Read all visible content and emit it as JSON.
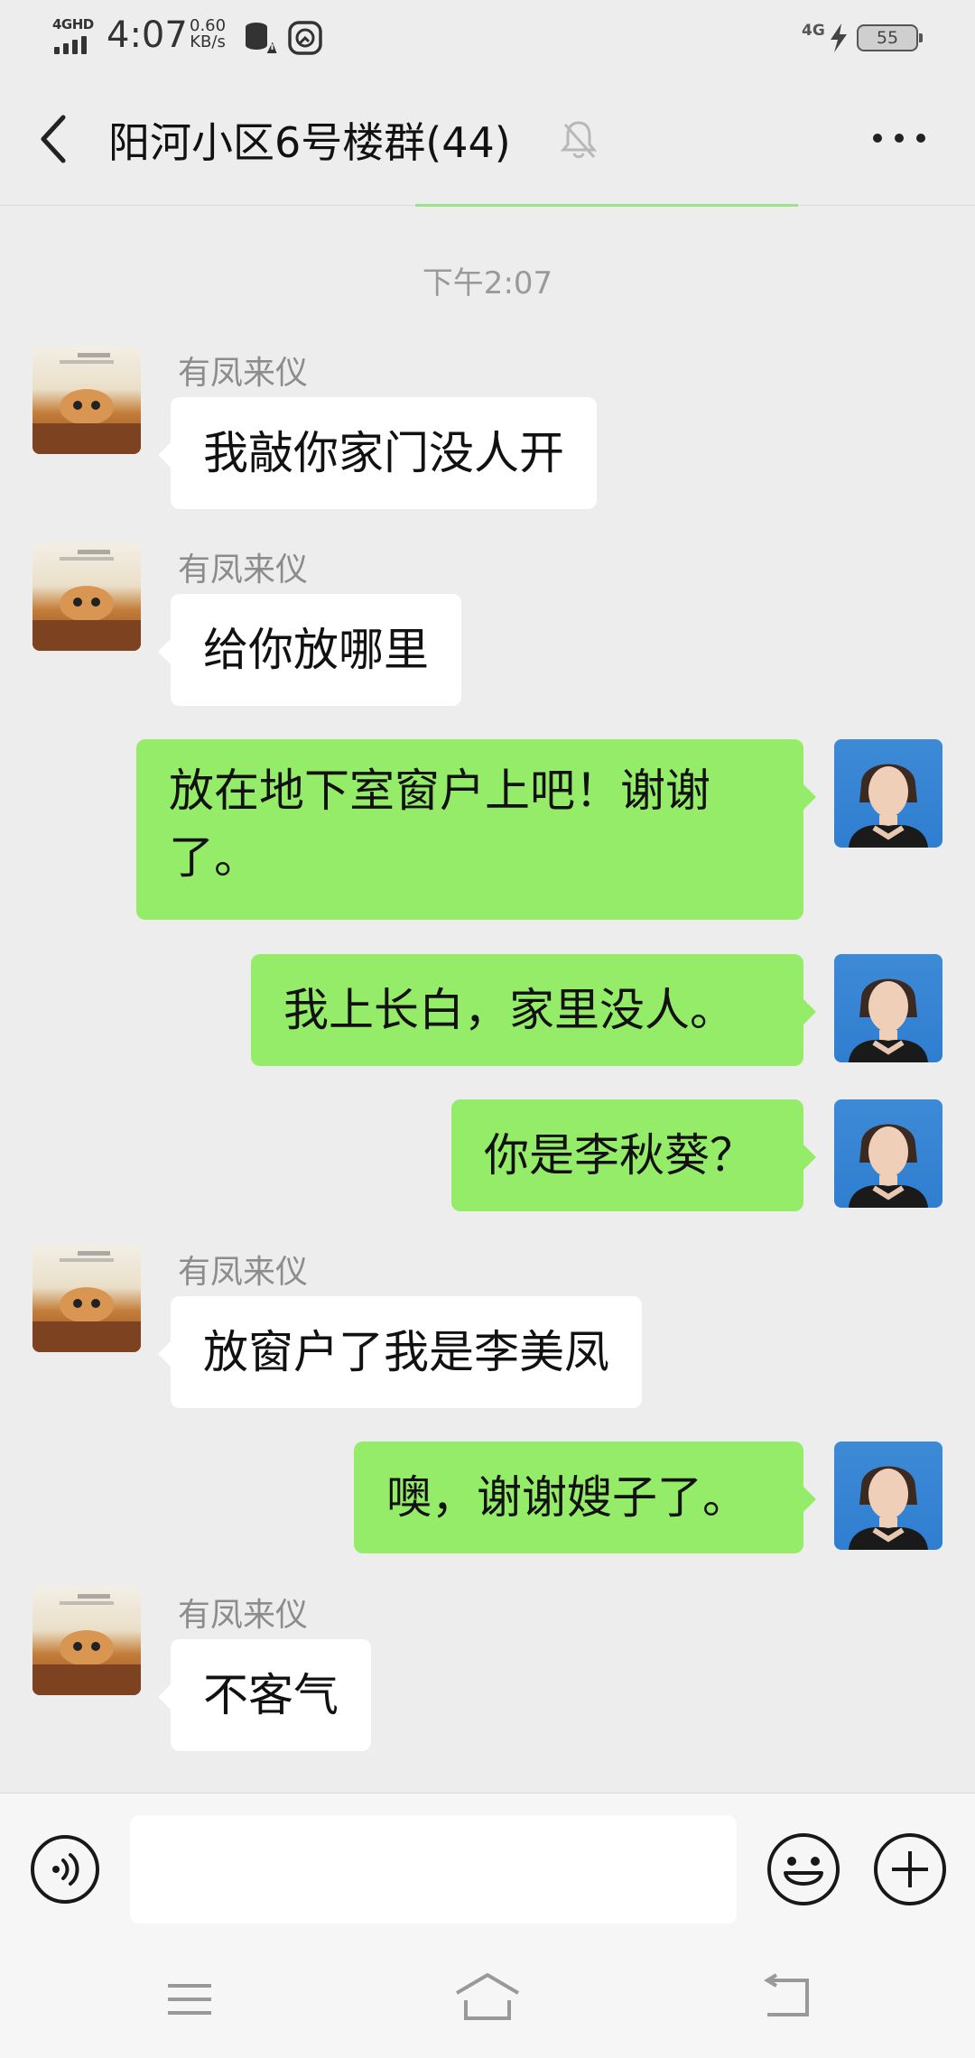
{
  "status_bar": {
    "network_label": "4GHD",
    "time": "4:07",
    "speed_value": "0.60",
    "speed_unit": "KB/s",
    "cell_label": "4G",
    "battery": "55"
  },
  "header": {
    "title": "阳河小区6号楼群(44)",
    "icons": [
      "back-arrow-icon",
      "mute-bell-icon",
      "more-dots-icon"
    ]
  },
  "timestamp": "下午2:07",
  "messages": [
    {
      "direction": "in",
      "sender": "有凤来仪",
      "text": "我敲你家门没人开"
    },
    {
      "direction": "in",
      "sender": "有凤来仪",
      "text": "给你放哪里"
    },
    {
      "direction": "out",
      "line1": "放在地下室窗户上吧！谢谢",
      "line2": "了。"
    },
    {
      "direction": "out",
      "text": "我上长白，家里没人。"
    },
    {
      "direction": "out",
      "text": "你是李秋葵？"
    },
    {
      "direction": "in",
      "sender": "有凤来仪",
      "text": "放窗户了我是李美凤"
    },
    {
      "direction": "out",
      "text": "噢，谢谢嫂子了。"
    },
    {
      "direction": "in",
      "sender": "有凤来仪",
      "text": "不客气"
    }
  ],
  "input_bar": {
    "placeholder": "",
    "icons": [
      "voice-icon",
      "emoji-icon",
      "plus-icon"
    ]
  },
  "nav_bar": {
    "icons": [
      "menu-icon",
      "home-icon",
      "back-icon"
    ]
  },
  "colors": {
    "background": "#ededed",
    "outgoing_bubble": "#95ec69",
    "incoming_bubble": "#ffffff",
    "sender_name": "#8c8c8c"
  }
}
